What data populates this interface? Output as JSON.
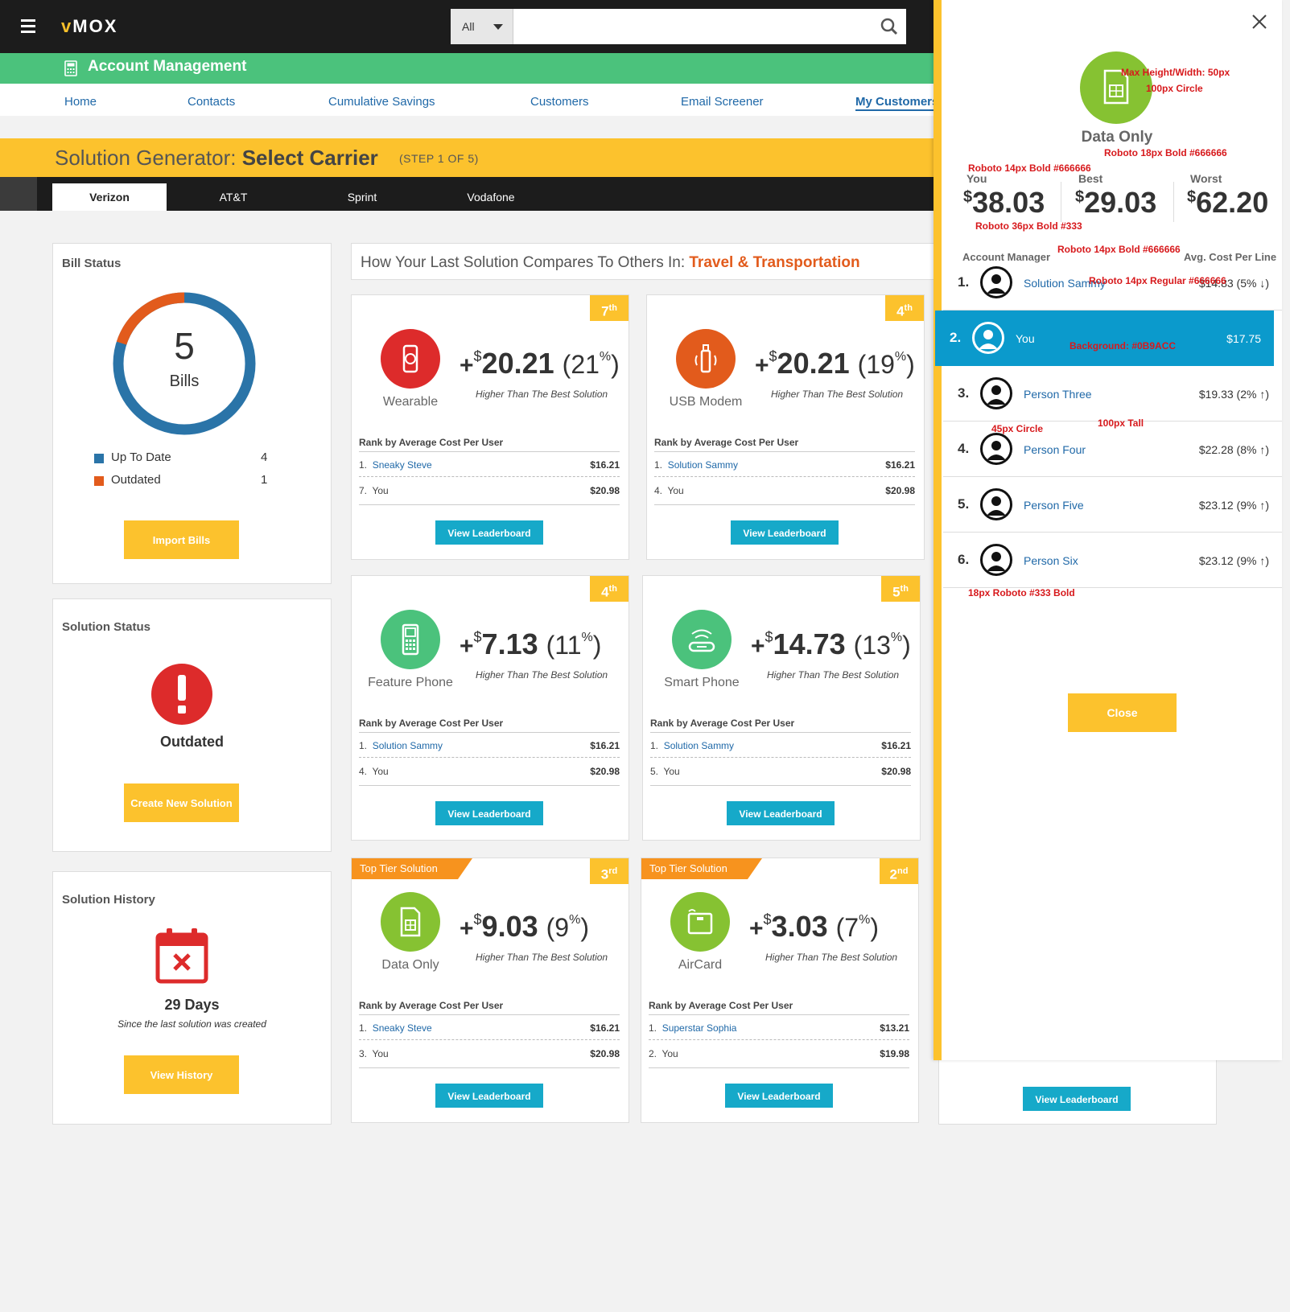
{
  "header": {
    "logo": "MOX",
    "logo_mark": "v",
    "search_scope": "All",
    "search_placeholder": ""
  },
  "section": {
    "title": "Account Management"
  },
  "nav": [
    "Home",
    "Contacts",
    "Cumulative Savings",
    "Customers",
    "Email Screener",
    "My Customers"
  ],
  "generator": {
    "title_light": "Solution Generator: ",
    "title_bold": "Select Carrier",
    "step": "(STEP 1 OF 5)"
  },
  "carriers": [
    "Verizon",
    "AT&T",
    "Sprint",
    "Vodafone"
  ],
  "bill_status": {
    "title": "Bill Status",
    "count": "5",
    "count_label": "Bills",
    "legend": [
      {
        "label": "Up To Date",
        "value": "4",
        "color": "#2a74a8"
      },
      {
        "label": "Outdated",
        "value": "1",
        "color": "#e25b1c"
      }
    ],
    "button": "Import Bills"
  },
  "solution_status": {
    "title": "Solution Status",
    "status": "Outdated",
    "button": "Create New Solution"
  },
  "solution_history": {
    "title": "Solution History",
    "days": "29 Days",
    "caption": "Since the last solution was created",
    "button": "View History"
  },
  "compare": {
    "prefix": "How Your Last Solution Compares To Others In: ",
    "industry": "Travel & Transportation"
  },
  "cards": [
    {
      "name": "Wearable",
      "color": "#dd2b2b",
      "icon": "watch-icon",
      "rank_num": "7",
      "rank_suffix": "th",
      "plus": "+",
      "dollar": "$",
      "amount": "20.21",
      "pct_num": "21",
      "pct_sym": "%",
      "higher": "Higher Than The Best Solution",
      "rank_by": "Rank by Average Cost Per User",
      "rows": [
        {
          "n": "1.",
          "name": "Sneaky Steve",
          "val": "$16.21"
        },
        {
          "n": "7.",
          "name": "You",
          "val": "$20.98"
        }
      ],
      "button": "View Leaderboard"
    },
    {
      "name": "USB Modem",
      "color": "#e25b1c",
      "icon": "usb-modem-icon",
      "rank_num": "4",
      "rank_suffix": "th",
      "plus": "+",
      "dollar": "$",
      "amount": "20.21",
      "pct_num": "19",
      "pct_sym": "%",
      "higher": "Higher Than The Best Solution",
      "rank_by": "Rank by Average Cost Per User",
      "rows": [
        {
          "n": "1.",
          "name": "Solution Sammy",
          "val": "$16.21"
        },
        {
          "n": "4.",
          "name": "You",
          "val": "$20.98"
        }
      ],
      "button": "View Leaderboard"
    },
    {
      "name": "Feature Phone",
      "color": "#4bc27c",
      "icon": "feature-phone-icon",
      "rank_num": "4",
      "rank_suffix": "th",
      "plus": "+",
      "dollar": "$",
      "amount": "7.13",
      "pct_num": "11",
      "pct_sym": "%",
      "higher": "Higher Than The Best Solution",
      "rank_by": "Rank by Average Cost Per User",
      "rows": [
        {
          "n": "1.",
          "name": "Solution Sammy",
          "val": "$16.21"
        },
        {
          "n": "4.",
          "name": "You",
          "val": "$20.98"
        }
      ],
      "button": "View Leaderboard"
    },
    {
      "name": "Smart Phone",
      "color": "#4bc27c",
      "icon": "router-icon",
      "rank_num": "5",
      "rank_suffix": "th",
      "plus": "+",
      "dollar": "$",
      "amount": "14.73",
      "pct_num": "13",
      "pct_sym": "%",
      "higher": "Higher Than The Best Solution",
      "rank_by": "Rank by Average Cost Per User",
      "rows": [
        {
          "n": "1.",
          "name": "Solution Sammy",
          "val": "$16.21"
        },
        {
          "n": "5.",
          "name": "You",
          "val": "$20.98"
        }
      ],
      "button": "View Leaderboard"
    },
    {
      "name": "Data Only",
      "color": "#86c232",
      "icon": "sim-card-icon",
      "rank_num": "3",
      "rank_suffix": "rd",
      "top_tier": "Top Tier Solution",
      "plus": "+",
      "dollar": "$",
      "amount": "9.03",
      "pct_num": "9",
      "pct_sym": "%",
      "higher": "Higher Than The Best Solution",
      "rank_by": "Rank by Average Cost Per User",
      "rows": [
        {
          "n": "1.",
          "name": "Sneaky Steve",
          "val": "$16.21"
        },
        {
          "n": "3.",
          "name": "You",
          "val": "$20.98"
        }
      ],
      "button": "View Leaderboard"
    },
    {
      "name": "AirCard",
      "color": "#86c232",
      "icon": "aircard-icon",
      "rank_num": "2",
      "rank_suffix": "nd",
      "top_tier": "Top Tier Solution",
      "plus": "+",
      "dollar": "$",
      "amount": "3.03",
      "pct_num": "7",
      "pct_sym": "%",
      "higher": "Higher Than The Best Solution",
      "rank_by": "Rank by Average Cost Per User",
      "rows": [
        {
          "n": "1.",
          "name": "Superstar Sophia",
          "val": "$13.21"
        },
        {
          "n": "2.",
          "name": "You",
          "val": "$19.98"
        }
      ],
      "button": "View Leaderboard"
    }
  ],
  "hidden_card_button": "View Leaderboard",
  "side_panel": {
    "title": "Data Only",
    "icon_color": "#86c232",
    "stats": [
      {
        "label": "You",
        "dollar": "$",
        "value": "38.03"
      },
      {
        "label": "Best",
        "dollar": "$",
        "value": "29.03"
      },
      {
        "label": "Worst",
        "dollar": "$",
        "value": "62.20"
      }
    ],
    "col_left": "Account Manager",
    "col_right": "Avg. Cost Per Line",
    "highlight_color": "#0B9ACC",
    "leaders": [
      {
        "n": "1.",
        "name": "Solution Sammy",
        "val": "$14.83 (5% ↓)"
      },
      {
        "n": "2.",
        "name": "You",
        "val": "$17.75"
      },
      {
        "n": "3.",
        "name": "Person Three",
        "val": "$19.33 (2% ↑)"
      },
      {
        "n": "4.",
        "name": "Person Four",
        "val": "$22.28 (8% ↑)"
      },
      {
        "n": "5.",
        "name": "Person Five",
        "val": "$23.12 (9% ↑)"
      },
      {
        "n": "6.",
        "name": "Person Six",
        "val": "$23.12 (9% ↑)"
      }
    ],
    "close_button": "Close",
    "annotations": {
      "max_size": "Max Height/Width: 50px",
      "circle100": "100px Circle",
      "title_font": "Roboto 18px Bold #666666",
      "label_font": "Roboto 14px Bold #666666",
      "price_font": "Roboto 36px Bold #333",
      "header_font": "Roboto 14px Bold #666666",
      "name_font": "Roboto 14px Regular #666666",
      "background": "Background: #0B9ACC",
      "circle45": "45px Circle",
      "tall100": "100px Tall",
      "num_font": "18px Roboto #333 Bold"
    }
  }
}
